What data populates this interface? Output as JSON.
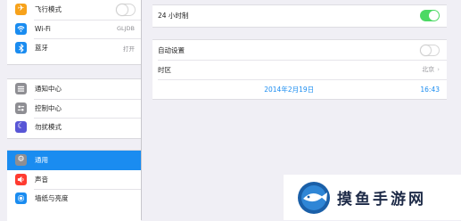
{
  "sidebar": {
    "group1": [
      {
        "label": "飞行模式",
        "icon": "airplane-icon",
        "color": "#f7a21b"
      },
      {
        "label": "Wi-Fi",
        "value": "GLJDB",
        "icon": "wifi-icon",
        "color": "#1a8cf0"
      },
      {
        "label": "蓝牙",
        "value": "打开",
        "icon": "bluetooth-icon",
        "color": "#1a8cf0"
      }
    ],
    "group2": [
      {
        "label": "通知中心",
        "icon": "notification-center-icon",
        "color": "#8e8e93"
      },
      {
        "label": "控制中心",
        "icon": "control-center-icon",
        "color": "#8e8e93"
      },
      {
        "label": "勿扰模式",
        "icon": "moon-icon",
        "color": "#5856d6"
      }
    ],
    "group3": [
      {
        "label": "通用",
        "icon": "gear-icon",
        "color": "#8e8e93",
        "selected": true
      },
      {
        "label": "声音",
        "icon": "speaker-icon",
        "color": "#ff3b30"
      },
      {
        "label": "墙纸与亮度",
        "icon": "wallpaper-icon",
        "color": "#1a8cf0"
      }
    ]
  },
  "main": {
    "hour24": {
      "label": "24 小时制",
      "on": true
    },
    "auto_set": {
      "label": "自动设置",
      "on": false
    },
    "timezone": {
      "label": "时区",
      "value": "北京"
    },
    "datetime": {
      "date": "2014年2月19日",
      "time": "16:43"
    }
  },
  "watermark": {
    "text": "摸鱼手游网"
  },
  "colors": {
    "accent": "#1a8cf0",
    "switch_on": "#4cd964"
  }
}
